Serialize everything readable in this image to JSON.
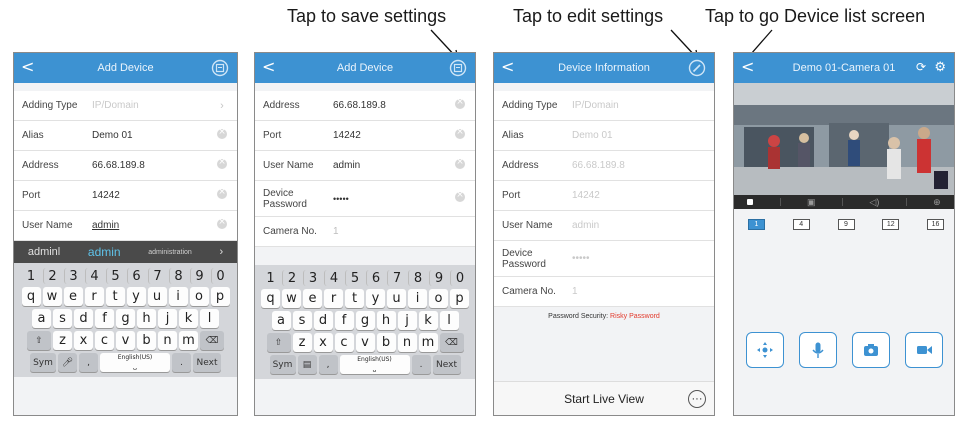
{
  "captions": {
    "save": "Tap to save settings",
    "edit": "Tap to edit settings",
    "back": "Tap to go Device list screen"
  },
  "screen1": {
    "title": "Add Device",
    "rows": [
      {
        "label": "Adding Type",
        "value": "IP/Domain"
      },
      {
        "label": "Alias",
        "value": "Demo 01"
      },
      {
        "label": "Address",
        "value": "66.68.189.8"
      },
      {
        "label": "Port",
        "value": "14242"
      },
      {
        "label": "User Name",
        "value": "admin"
      }
    ],
    "suggestions": [
      "adminl",
      "admin",
      "administration"
    ],
    "keyboard": {
      "numbers": [
        "1",
        "2",
        "3",
        "4",
        "5",
        "6",
        "7",
        "8",
        "9",
        "0"
      ],
      "row1": [
        "q",
        "w",
        "e",
        "r",
        "t",
        "y",
        "u",
        "i",
        "o",
        "p"
      ],
      "row2": [
        "a",
        "s",
        "d",
        "f",
        "g",
        "h",
        "j",
        "k",
        "l"
      ],
      "row3": [
        "z",
        "x",
        "c",
        "v",
        "b",
        "n",
        "m"
      ],
      "sym": "Sym",
      "space": "English(US)",
      "comma": ",",
      "period": ".",
      "next": "Next"
    }
  },
  "screen2": {
    "title": "Add Device",
    "rows": [
      {
        "label": "Address",
        "value": "66.68.189.8"
      },
      {
        "label": "Port",
        "value": "14242"
      },
      {
        "label": "User Name",
        "value": "admin"
      },
      {
        "label": "Device Password",
        "value": "•••••"
      },
      {
        "label": "Camera No.",
        "value": "1"
      }
    ]
  },
  "screen3": {
    "title": "Device Information",
    "rows": [
      {
        "label": "Adding Type",
        "value": "IP/Domain"
      },
      {
        "label": "Alias",
        "value": "Demo 01"
      },
      {
        "label": "Address",
        "value": "66.68.189.8"
      },
      {
        "label": "Port",
        "value": "14242"
      },
      {
        "label": "User Name",
        "value": "admin"
      },
      {
        "label": "Device Password",
        "value": "•••••"
      },
      {
        "label": "Camera No.",
        "value": "1"
      }
    ],
    "security_label": "Password Security:",
    "security_value": "Risky Password",
    "start_live": "Start Live View",
    "more": "···"
  },
  "screen4": {
    "title": "Demo 01-Camera 01",
    "channels": [
      "1",
      "4",
      "9",
      "12",
      "16"
    ]
  },
  "colors": {
    "header": "#3d92d2",
    "risk": "#e23a2c"
  }
}
